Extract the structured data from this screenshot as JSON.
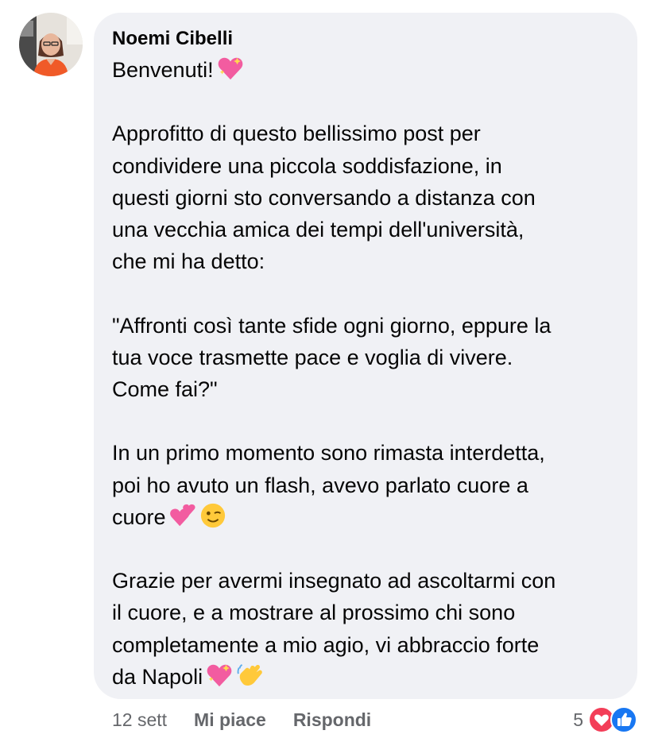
{
  "comment": {
    "author": "Noemi Cibelli",
    "paragraphs": [
      [
        "Benvenuti!"
      ],
      [
        "Approfitto di questo bellissimo post per",
        "condividere una piccola soddisfazione, in",
        "questi giorni sto conversando a distanza con",
        "una vecchia amica dei tempi dell'università,",
        "che mi ha detto:"
      ],
      [
        "\"Affronti così tante sfide ogni giorno, eppure la",
        "tua voce trasmette pace e voglia di vivere.",
        "Come fai?\""
      ],
      [
        "In un primo momento sono rimasta interdetta,",
        "poi ho avuto un flash, avevo parlato cuore a",
        "cuore"
      ],
      [
        "Grazie per avermi insegnato ad ascoltarmi con",
        "il cuore, e a mostrare al prossimo chi sono",
        "completamente a mio agio, vi abbraccio forte",
        "da Napoli"
      ]
    ],
    "emojis": {
      "p0": [
        "sparkling-heart"
      ],
      "p3": [
        "two-hearts",
        "winking-face"
      ],
      "p4": [
        "sparkling-heart",
        "waving-hand"
      ]
    }
  },
  "actions": {
    "timestamp": "12 sett",
    "like_label": "Mi piace",
    "reply_label": "Rispondi"
  },
  "reactions": {
    "count": "5",
    "icons": [
      "love-reaction-icon",
      "like-reaction-icon"
    ]
  },
  "colors": {
    "bubble": "#f0f1f5",
    "text": "#050505",
    "meta": "#65676b",
    "love": "#f33e58",
    "like": "#1877f2"
  }
}
